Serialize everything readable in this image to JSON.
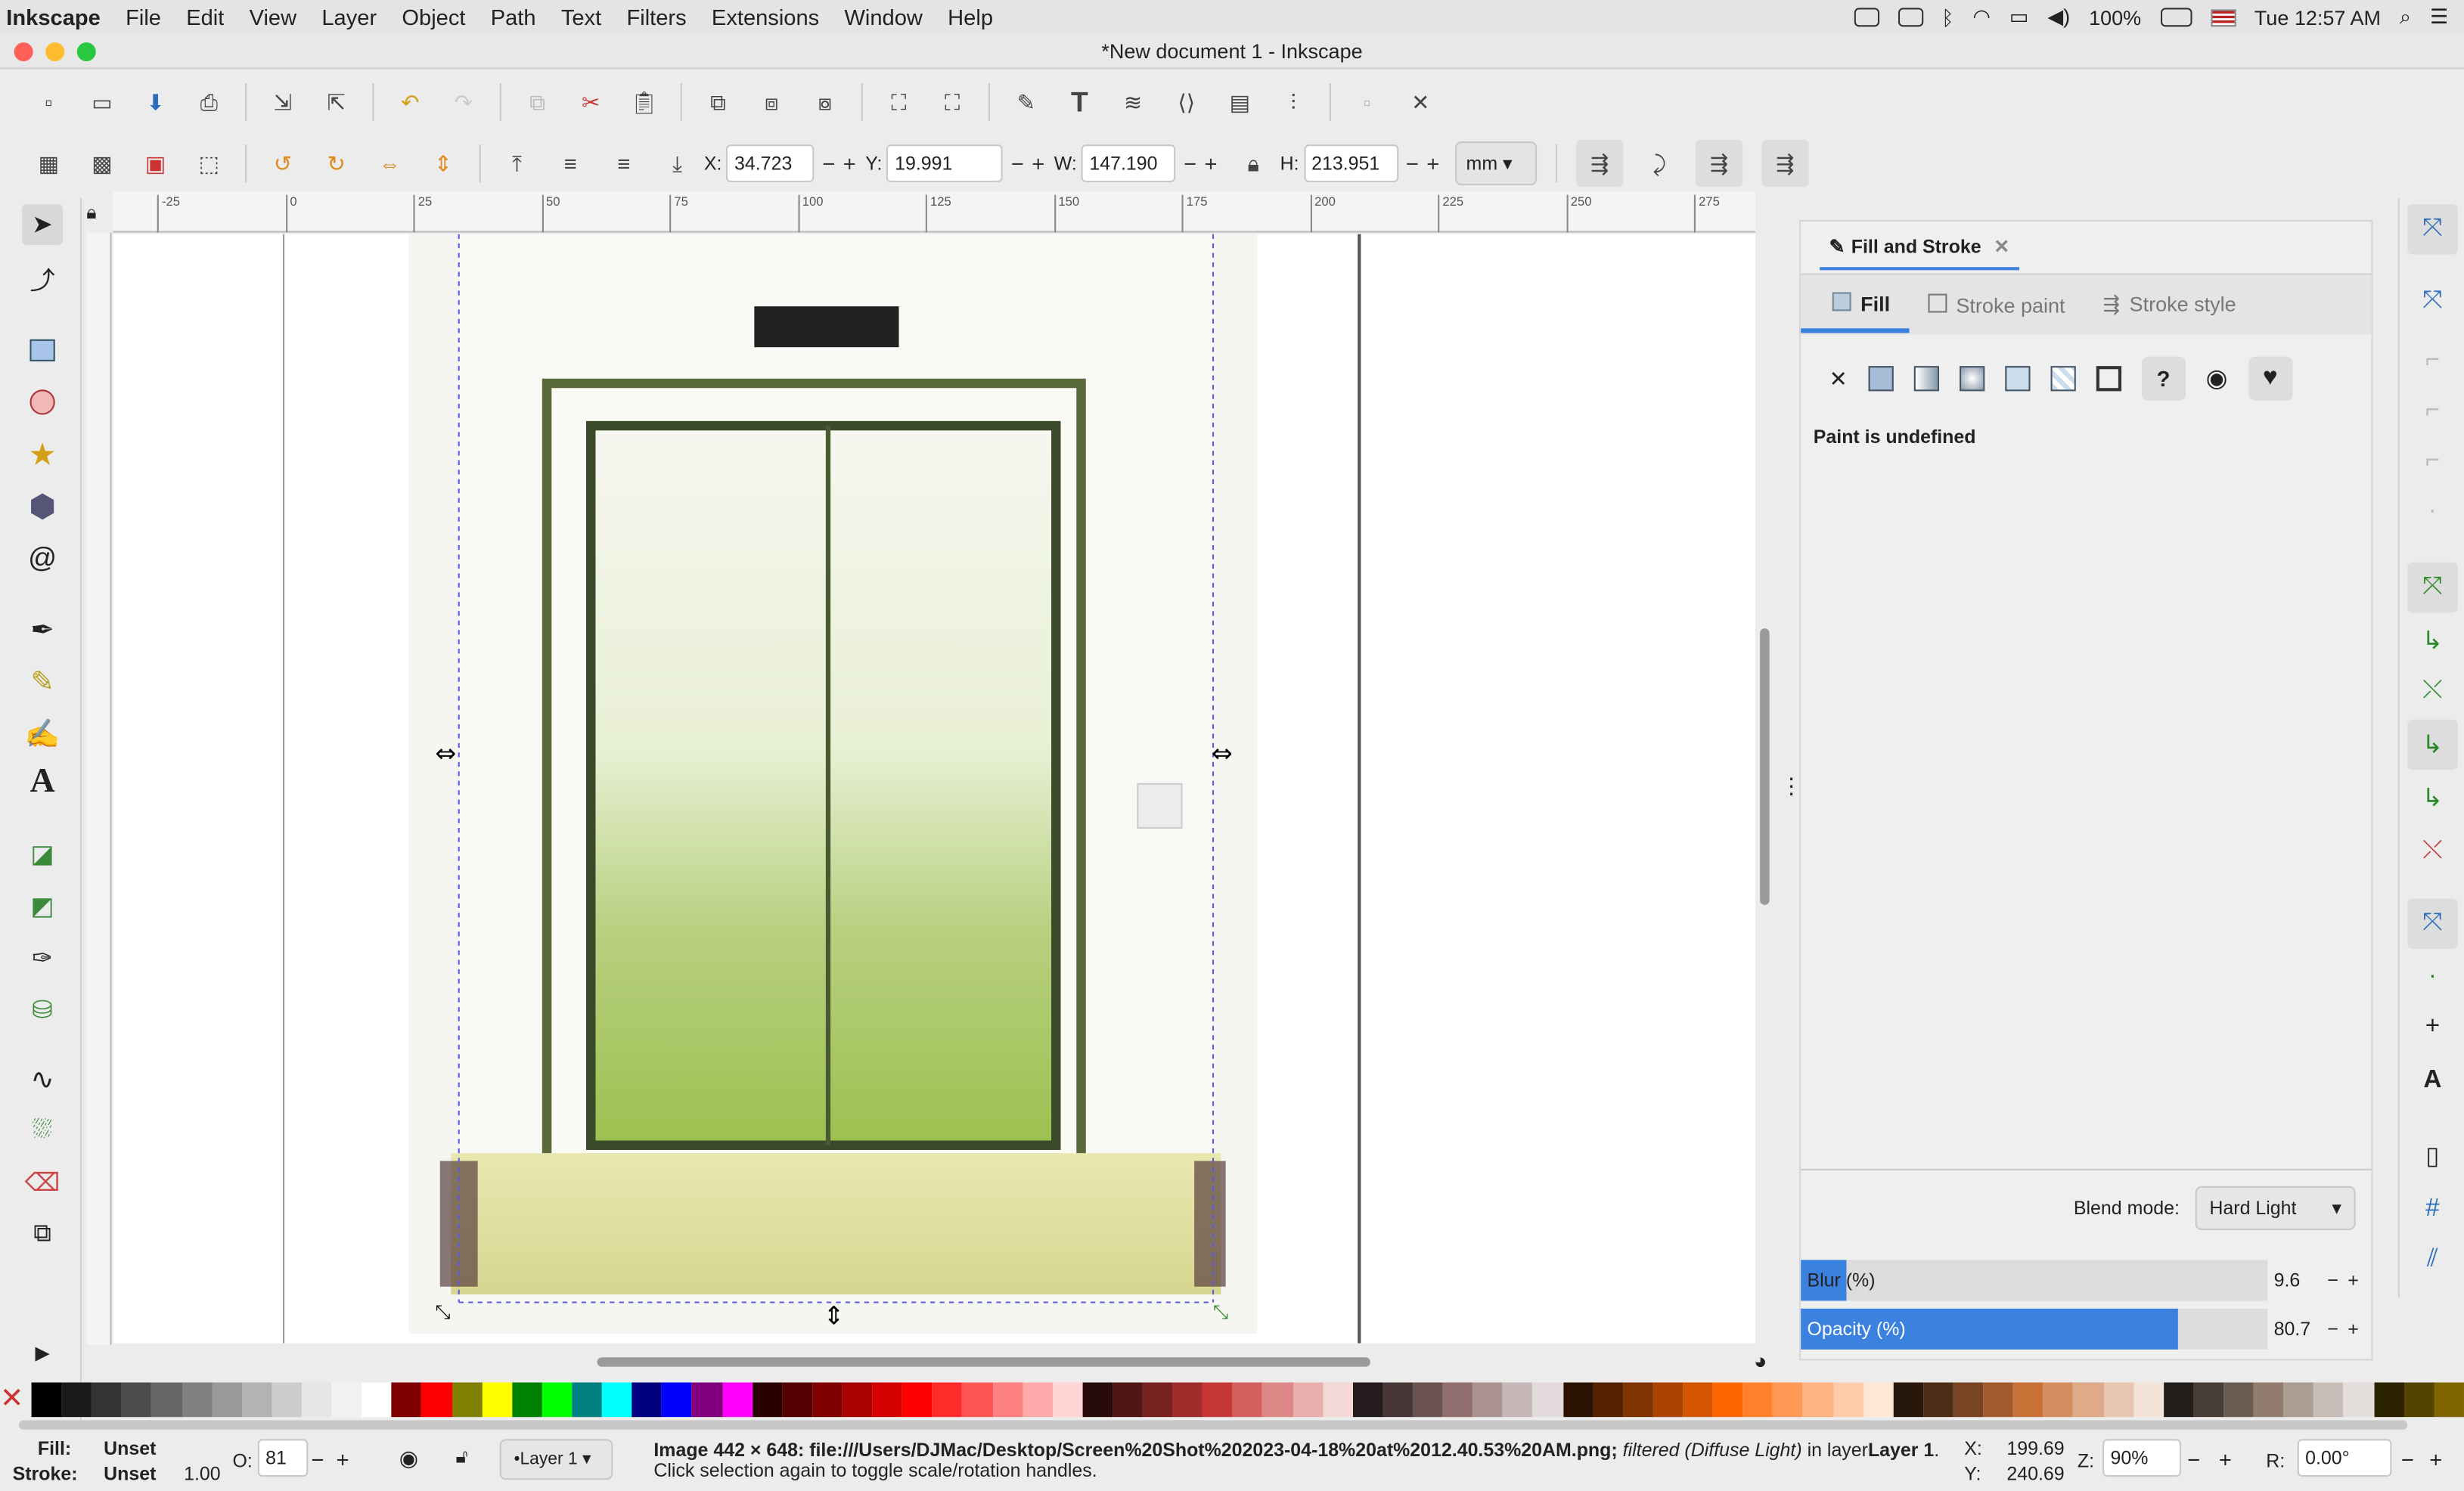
{
  "menubar": {
    "app": "Inkscape",
    "items": [
      "File",
      "Edit",
      "View",
      "Layer",
      "Object",
      "Path",
      "Text",
      "Filters",
      "Extensions",
      "Window",
      "Help"
    ],
    "battery": "100%",
    "clock": "Tue 12:57 AM"
  },
  "window": {
    "title": "*New document 1 - Inkscape"
  },
  "toolbar": {
    "x_label": "X:",
    "x_value": "34.723",
    "y_label": "Y:",
    "y_value": "19.991",
    "w_label": "W:",
    "w_value": "147.190",
    "h_label": "H:",
    "h_value": "213.951",
    "units": "mm"
  },
  "ruler": {
    "ticks": [
      "-25",
      "0",
      "25",
      "50",
      "75",
      "100",
      "125",
      "150",
      "175",
      "200",
      "225",
      "250",
      "275"
    ]
  },
  "panel": {
    "title": "Fill and Stroke",
    "tabs": [
      "Fill",
      "Stroke paint",
      "Stroke style"
    ],
    "paint_status": "Paint is undefined",
    "blend_label": "Blend mode:",
    "blend_value": "Hard Light",
    "blur_label": "Blur (%)",
    "blur_value": "9.6",
    "blur_fraction": 0.096,
    "opacity_label": "Opacity (%)",
    "opacity_value": "80.7",
    "opacity_fraction": 0.807
  },
  "statusbar": {
    "fill_label": "Fill:",
    "fill_value": "Unset",
    "stroke_label": "Stroke:",
    "stroke_value": "Unset",
    "stroke_width": "1.00",
    "opacity_label": "O:",
    "opacity_value": "81",
    "layer": "•Layer 1",
    "message_1": "Image 442 × 648: file:///Users/DJMac/Desktop/Screen%20Shot%202023-04-18%20at%2012.40.53%20AM.png;",
    "message_filter": "filtered (Diffuse Light)",
    "message_2": "in layer",
    "message_layer": "Layer 1",
    "message_3": ". Click selection again to toggle scale/rotation handles.",
    "cursor_x_label": "X:",
    "cursor_x": "199.69",
    "cursor_y_label": "Y:",
    "cursor_y": "240.69",
    "zoom_label": "Z:",
    "zoom": "90%",
    "rotation_label": "R:",
    "rotation": "0.00°"
  },
  "colors": {
    "accent": "#3b82e0",
    "selection": "#5a5ae6"
  }
}
